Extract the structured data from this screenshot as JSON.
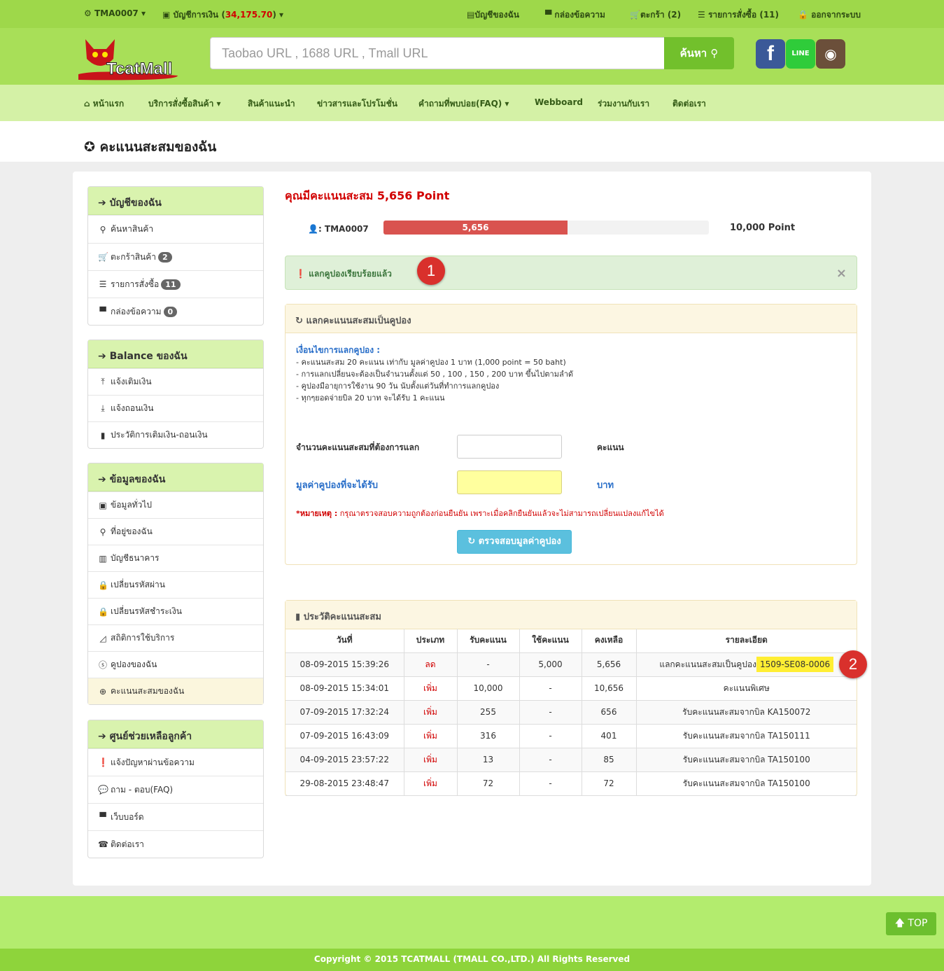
{
  "topbar": {
    "user": "TMA0007",
    "wallet_label": "บัญชีการเงิน",
    "wallet_amount": "34,175.70",
    "my_account": "บัญชีของฉัน",
    "inbox": "กล่องข้อความ",
    "cart": "ตะกร้า (2)",
    "orders": "รายการสั่งซื้อ (11)",
    "logout": "ออกจากระบบ"
  },
  "header": {
    "search_placeholder": "Taobao URL , 1688 URL , Tmall URL",
    "search_button": "ค้นหา",
    "logo_text": "TcatMall"
  },
  "nav": [
    "หน้าแรก",
    "บริการสั่งซื้อสินค้า",
    "สินค้าแนะนำ",
    "ข่าวสารและโปรโมชั่น",
    "คำถามที่พบบ่อย(FAQ)",
    "Webboard",
    "ร่วมงานกับเรา",
    "ติดต่อเรา"
  ],
  "page_title": "คะแนนสะสมของฉัน",
  "sidebar": {
    "account": {
      "title": "บัญชีของฉัน",
      "items": [
        "ค้นหาสินค้า",
        "ตะกร้าสินค้า",
        "รายการสั่งซื้อ",
        "กล่องข้อความ"
      ],
      "badges": [
        "2",
        "11",
        "0"
      ]
    },
    "balance": {
      "title": "Balance ของฉัน",
      "items": [
        "แจ้งเติมเงิน",
        "แจ้งถอนเงิน",
        "ประวัติการเติมเงิน-ถอนเงิน"
      ]
    },
    "profile": {
      "title": "ข้อมูลของฉัน",
      "items": [
        "ข้อมูลทั่วไป",
        "ที่อยู่ของฉัน",
        "บัญชีธนาคาร",
        "เปลี่ยนรหัสผ่าน",
        "เปลี่ยนรหัสชำระเงิน",
        "สถิติการใช้บริการ",
        "คูปองของฉัน",
        "คะแนนสะสมของฉัน"
      ]
    },
    "help": {
      "title": "ศูนย์ช่วยเหลือลูกค้า",
      "items": [
        "แจ้งปัญหาผ่านข้อความ",
        "ถาม - ตอบ(FAQ)",
        "เว็บบอร์ด",
        "ติดต่อเรา"
      ]
    }
  },
  "points": {
    "headline": "คุณมีคะแนนสะสม 5,656 Point",
    "user": ": TMA0007",
    "current": 5656,
    "current_label": "5,656",
    "max": 10000,
    "max_label": "10,000 Point"
  },
  "alert": {
    "text": "แลกคูปองเรียบร้อยแล้ว",
    "close": "×"
  },
  "markers": [
    "1",
    "2"
  ],
  "exchange": {
    "title": "แลกคะแนนสะสมเป็นคูปอง",
    "cond_title": "เงื่อนไขการแลกคูปอง :",
    "conditions": [
      "- คะแนนสะสม 20 คะแนน เท่ากับ มูลค่าคูปอง 1 บาท  (1,000 point = 50 baht)",
      "- การแลกเปลี่ยนจะต้องเป็นจำนวนตั้งแต่   50 , 100 , 150 , 200 บาท ขึ้นไปตามลำดั",
      "- คูปองมีอายุการใช้งาน 90 วัน นับตั้งแต่วันที่ทำการแลกคูปอง",
      "- ทุกๆยอดจ่ายบิล 20 บาท จะได้รับ 1 คะแนน"
    ],
    "points_label": "จำนวนคะแนนสะสมที่ต้องการแลก",
    "points_unit": "คะแนน",
    "value_label": "มูลค่าคูปองที่จะได้รับ",
    "value_unit": "บาท",
    "note_bold": "*หมายเหตุ :",
    "note": " กรุณาตรวจสอบความถูกต้องก่อนยืนยัน เพราะเมื่อคลิกยืนยันแล้วจะไม่สามารถเปลี่ยนแปลงแก้ไขได้",
    "check_button": "ตรวจสอบมูลค่าคูปอง"
  },
  "history": {
    "title": "ประวัติคะแนนสะสม",
    "columns": [
      "วันที่",
      "ประเภท",
      "รับคะแนน",
      "ใช้คะแนน",
      "คงเหลือ",
      "รายละเอียด"
    ],
    "rows": [
      [
        "08-09-2015 15:39:26",
        "ลด",
        "-",
        "5,000",
        "5,656",
        "แลกคะแนนสะสมเป็นคูปอง",
        "1509-SE08-0006"
      ],
      [
        "08-09-2015 15:34:01",
        "เพิ่ม",
        "10,000",
        "-",
        "10,656",
        "คะแนนพิเศษ",
        ""
      ],
      [
        "07-09-2015 17:32:24",
        "เพิ่ม",
        "255",
        "-",
        "656",
        "รับคะแนนสะสมจากบิล KA150072",
        ""
      ],
      [
        "07-09-2015 16:43:09",
        "เพิ่ม",
        "316",
        "-",
        "401",
        "รับคะแนนสะสมจากบิล TA150111",
        ""
      ],
      [
        "04-09-2015 23:57:22",
        "เพิ่ม",
        "13",
        "-",
        "85",
        "รับคะแนนสะสมจากบิล TA150100",
        ""
      ],
      [
        "29-08-2015 23:48:47",
        "เพิ่ม",
        "72",
        "-",
        "72",
        "รับคะแนนสะสมจากบิล TA150100",
        ""
      ]
    ]
  },
  "footer": {
    "copyright": "Copyright © 2015 TCATMALL (TMALL CO.,LTD.) All Rights Reserved",
    "top_button": "TOP"
  },
  "colors": {
    "green": "#9ed84a",
    "red": "#d10000",
    "progress": "#d9534f",
    "info": "#5bc0de"
  }
}
